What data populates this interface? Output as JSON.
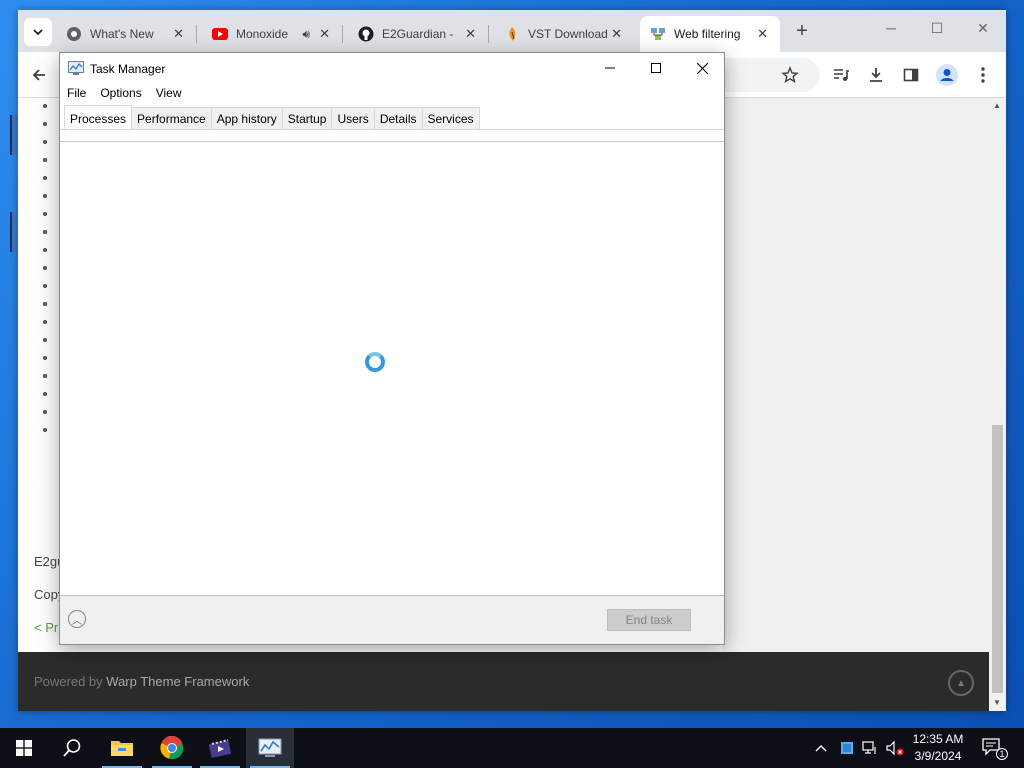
{
  "browser": {
    "tabs": [
      {
        "title": "What's New",
        "favicon": "chrome-icon"
      },
      {
        "title": "Monoxide",
        "favicon": "youtube-icon"
      },
      {
        "title": "E2Guardian - ",
        "favicon": "github-icon"
      },
      {
        "title": "VST Download",
        "favicon": "fl-studio-icon"
      },
      {
        "title": "Web filtering",
        "favicon": "network-icon"
      }
    ],
    "new_tab_label": "+",
    "page": {
      "text_1": "E2gu",
      "text_2": "Copy",
      "link_text": "< Pr",
      "footer_prefix": "Powered by",
      "footer_brand": "Warp Theme Framework"
    }
  },
  "task_manager": {
    "title": "Task Manager",
    "menu": [
      "File",
      "Options",
      "View"
    ],
    "tabs": [
      "Processes",
      "Performance",
      "App history",
      "Startup",
      "Users",
      "Details",
      "Services"
    ],
    "active_tab": "Processes",
    "end_task_label": "End task"
  },
  "taskbar": {
    "clock_time": "12:35 AM",
    "clock_date": "3/9/2024",
    "notification_count": "1",
    "pinned": [
      "start-icon",
      "search-icon",
      "file-explorer-icon",
      "chrome-icon",
      "media-icon",
      "task-manager-icon"
    ]
  },
  "colors": {
    "accent": "#3a96dd",
    "taskbar_bg": "#0c0f16",
    "desktop": "#1769cf"
  }
}
